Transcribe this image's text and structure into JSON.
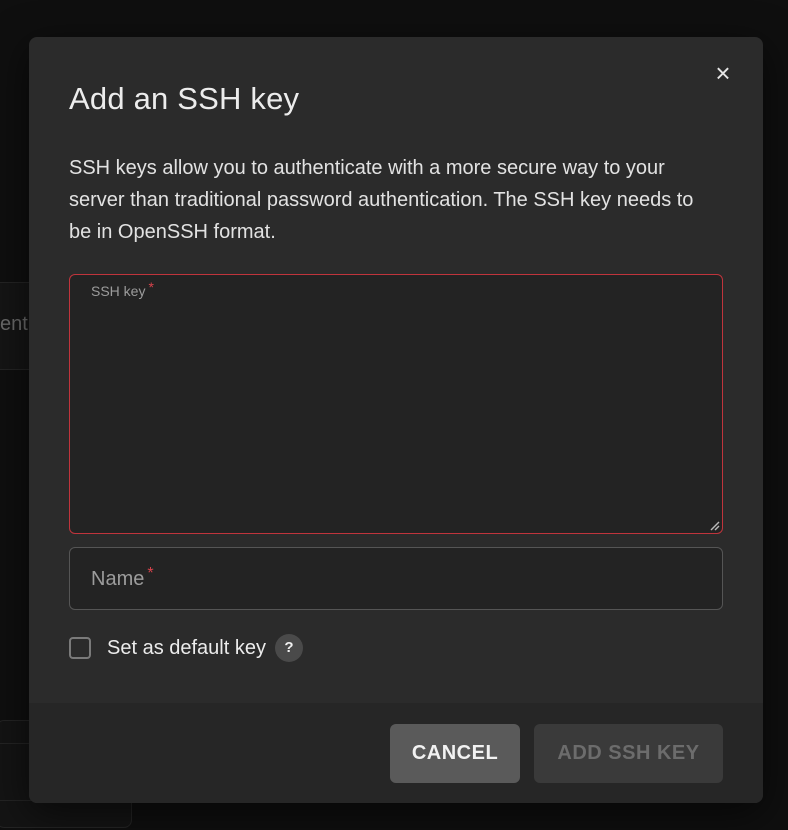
{
  "background": {
    "partial_text": "ent"
  },
  "dialog": {
    "title": "Add an SSH key",
    "description": "SSH keys allow you to authenticate with a more secure way to your server than traditional password authentication. The SSH key needs to be in OpenSSH format.",
    "close_icon": "×",
    "ssh_key_field": {
      "label": "SSH key",
      "required_marker": "*",
      "value": "",
      "state": "error",
      "border_color": "#c0343c"
    },
    "name_field": {
      "label": "Name",
      "required_marker": "*",
      "value": ""
    },
    "default_checkbox": {
      "label": "Set as default key",
      "checked": false,
      "help_icon": "?"
    },
    "footer": {
      "cancel_label": "CANCEL",
      "add_label": "ADD SSH KEY",
      "add_enabled": false
    }
  },
  "colors": {
    "backdrop": "#0f0f0f",
    "dialog_bg": "#2b2b2b",
    "required": "#d9434c",
    "error_border": "#c0343c"
  }
}
